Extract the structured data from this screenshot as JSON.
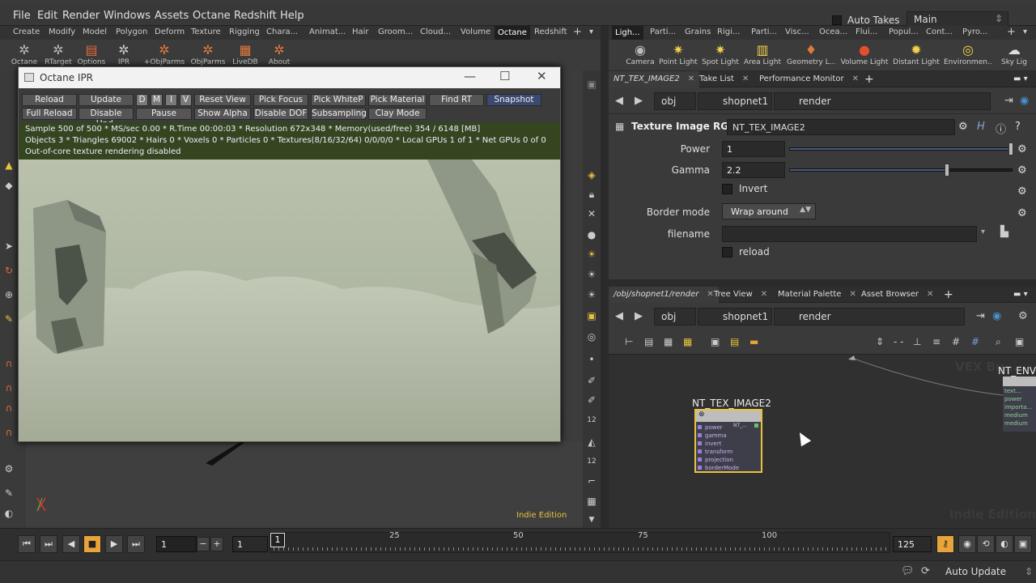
{
  "menubar": {
    "items": [
      "File",
      "Edit",
      "Render",
      "Windows",
      "Assets",
      "Octane",
      "Redshift",
      "Help"
    ],
    "auto_takes": "Auto Takes",
    "desktop": "Main"
  },
  "shelf_left": {
    "tabs": [
      "Create",
      "Modify",
      "Model",
      "Polygon",
      "Deform",
      "Texture",
      "Rigging",
      "Chara...",
      "Animat...",
      "Hair",
      "Groom...",
      "Cloud...",
      "Volume",
      "Octane",
      "Redshift"
    ],
    "active_tab": "Octane",
    "tools": [
      "Octane",
      "RTarget",
      "Options",
      "IPR",
      "+ObjParms",
      "ObjParms",
      "LiveDB",
      "About"
    ]
  },
  "shelf_right": {
    "tabs": [
      "Ligh...",
      "Parti...",
      "Grains",
      "Rigi...",
      "Parti...",
      "Visc...",
      "Ocea...",
      "Flui...",
      "Popul...",
      "Cont...",
      "Pyro..."
    ],
    "tools": [
      "Camera",
      "Point Light",
      "Spot Light",
      "Area Light",
      "Geometry L...",
      "Volume Light",
      "Distant Light",
      "Environmen...",
      "Sky Lig"
    ]
  },
  "ipr": {
    "title": "Octane IPR",
    "row1": [
      "Reload",
      "Update",
      "D",
      "M",
      "I",
      "V",
      "Reset View",
      "Pick Focus",
      "Pick WhiteP",
      "Pick Material",
      "Find RT",
      "Snapshot"
    ],
    "row2": [
      "Full Reload",
      "Disable Upd.",
      "Pause",
      "Show Alpha",
      "Disable DOF",
      "Subsampling",
      "Clay Mode"
    ],
    "info": [
      "Sample 500 of 500 * MS/sec 0.00 * R.Time 00:00:03 * Resolution 672x348 * Memory(used/free) 354 / 6148 [MB]",
      "Objects 3 * Triangles 69002 * Hairs 0 * Voxels 0 * Particles 0 * Textures(8/16/32/64) 0/0/0/0 * Local GPUs 1 of 1 * Net GPUs 0 of 0",
      "Out-of-core texture rendering disabled"
    ]
  },
  "viewport": {
    "edition": "Indie Edition"
  },
  "params": {
    "tabs": [
      "NT_TEX_IMAGE2",
      "Take List",
      "Performance Monitor"
    ],
    "path": [
      "obj",
      "shopnet1",
      "render"
    ],
    "node_type": "Texture Image RGB",
    "node_name": "NT_TEX_IMAGE2",
    "power_label": "Power",
    "power": "1",
    "power_fraction": 1.0,
    "gamma_label": "Gamma",
    "gamma": "2.2",
    "gamma_fraction": 0.71,
    "invert_label": "Invert",
    "border_label": "Border mode",
    "border_value": "Wrap around",
    "filename_label": "filename",
    "filename": "",
    "reload_label": "reload"
  },
  "network": {
    "tabs": [
      "/obj/shopnet1/render",
      "Tree View",
      "Material Palette",
      "Asset Browser"
    ],
    "path": [
      "obj",
      "shopnet1",
      "render"
    ],
    "node_label": "NT_TEX_IMAGE2",
    "node_out": "NT_...",
    "ports": [
      "power",
      "gamma",
      "invert",
      "transform",
      "projection",
      "borderMode"
    ],
    "env_label": "NT_ENV",
    "env_ports": [
      "text...",
      "power",
      "importa...",
      "medium",
      "medium"
    ],
    "vex_bg": "VEX Bu...",
    "edition": "Indie Edition"
  },
  "timeline": {
    "frame": "1",
    "start": "1",
    "current": "1",
    "ticks": [
      "25",
      "50",
      "75",
      "100"
    ],
    "end": "125"
  },
  "status": {
    "auto_update": "Auto Update"
  }
}
